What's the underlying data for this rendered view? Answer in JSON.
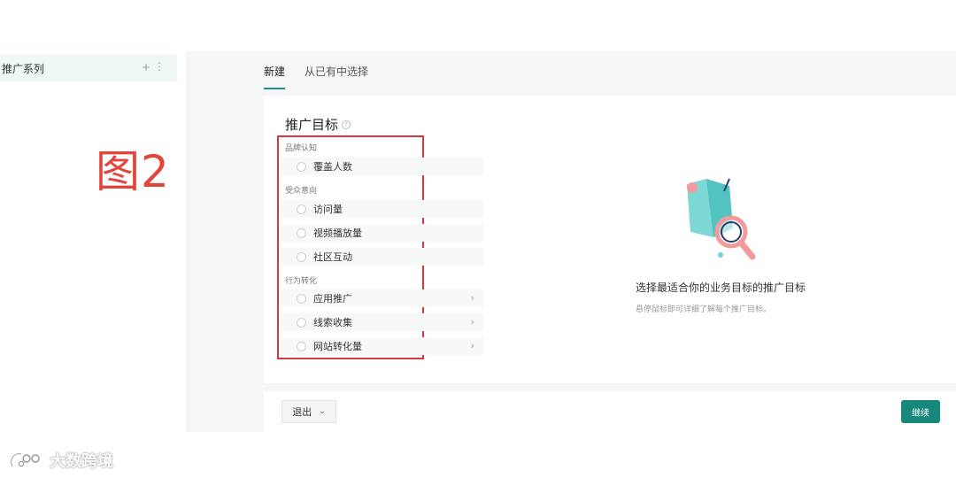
{
  "sidebar": {
    "series_label": "推广系列",
    "add_glyph": "+",
    "more_glyph": "⋮"
  },
  "figure_label": "图2",
  "tabs": [
    {
      "label": "新建",
      "active": true
    },
    {
      "label": "从已有中选择",
      "active": false
    }
  ],
  "card": {
    "title": "推广目标",
    "help_glyph": "?",
    "groups": [
      {
        "label": "品牌认知",
        "options": [
          {
            "label": "覆盖人数",
            "has_chevron": false
          }
        ]
      },
      {
        "label": "受众意向",
        "options": [
          {
            "label": "访问量",
            "has_chevron": false
          },
          {
            "label": "视频播放量",
            "has_chevron": false
          },
          {
            "label": "社区互动",
            "has_chevron": false
          }
        ]
      },
      {
        "label": "行为转化",
        "options": [
          {
            "label": "应用推广",
            "has_chevron": true
          },
          {
            "label": "线索收集",
            "has_chevron": true
          },
          {
            "label": "网站转化量",
            "has_chevron": true
          }
        ]
      }
    ],
    "chevron_glyph": "›",
    "empty_state": {
      "icon": "map-search-icon",
      "title": "选择最适合你的业务目标的推广目标",
      "subtitle": "悬停鼠标即可详细了解每个推广目标。"
    }
  },
  "footer": {
    "exit_label": "退出",
    "exit_chevron": "⌄",
    "continue_label": "继续"
  },
  "watermark": {
    "text": "大数跨境"
  },
  "colors": {
    "accent": "#17877c",
    "highlight": "#d9363e",
    "figure_label": "#e0463d"
  }
}
